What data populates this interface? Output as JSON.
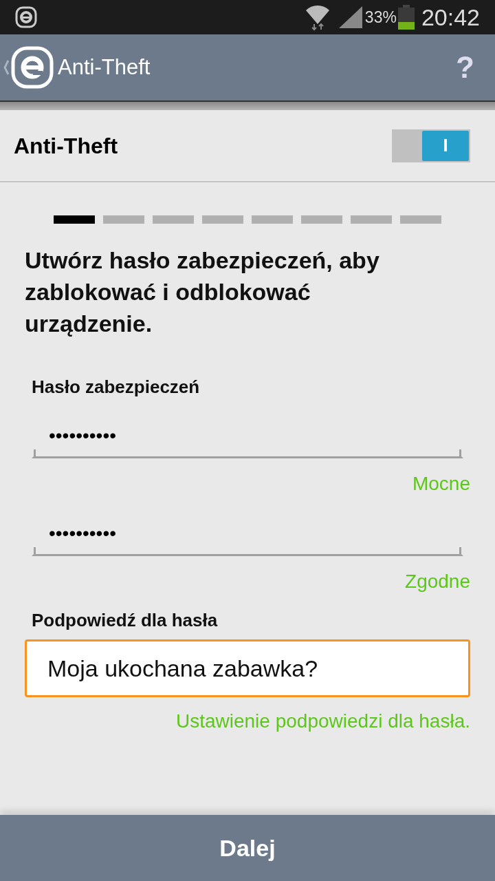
{
  "status_bar": {
    "battery_text": "33%",
    "time": "20:42"
  },
  "app_bar": {
    "title": "Anti-Theft",
    "help": "?"
  },
  "toggle": {
    "label": "Anti-Theft",
    "on": true,
    "switch_text": "I"
  },
  "steps": [
    {
      "selected": true
    },
    {
      "selected": false
    },
    {
      "selected": false
    },
    {
      "selected": false
    },
    {
      "selected": false
    },
    {
      "selected": false
    },
    {
      "selected": false
    },
    {
      "selected": false
    }
  ],
  "heading": "Utwórz hasło zabezpieczeń, aby zablokować i odblokować urządzenie.",
  "password_label": "Hasło zabezpieczeń",
  "password_fields": [
    {
      "value": "••••••••••",
      "status": "Mocne"
    },
    {
      "value": "••••••••••",
      "status": "Zgodne"
    }
  ],
  "hint": {
    "label": "Podpowiedź dla hasła",
    "value": "Moja ukochana zabawka?",
    "focused": true,
    "helper": "Ustawienie podpowiedzi dla hasła."
  },
  "next_button": "Dalej"
}
